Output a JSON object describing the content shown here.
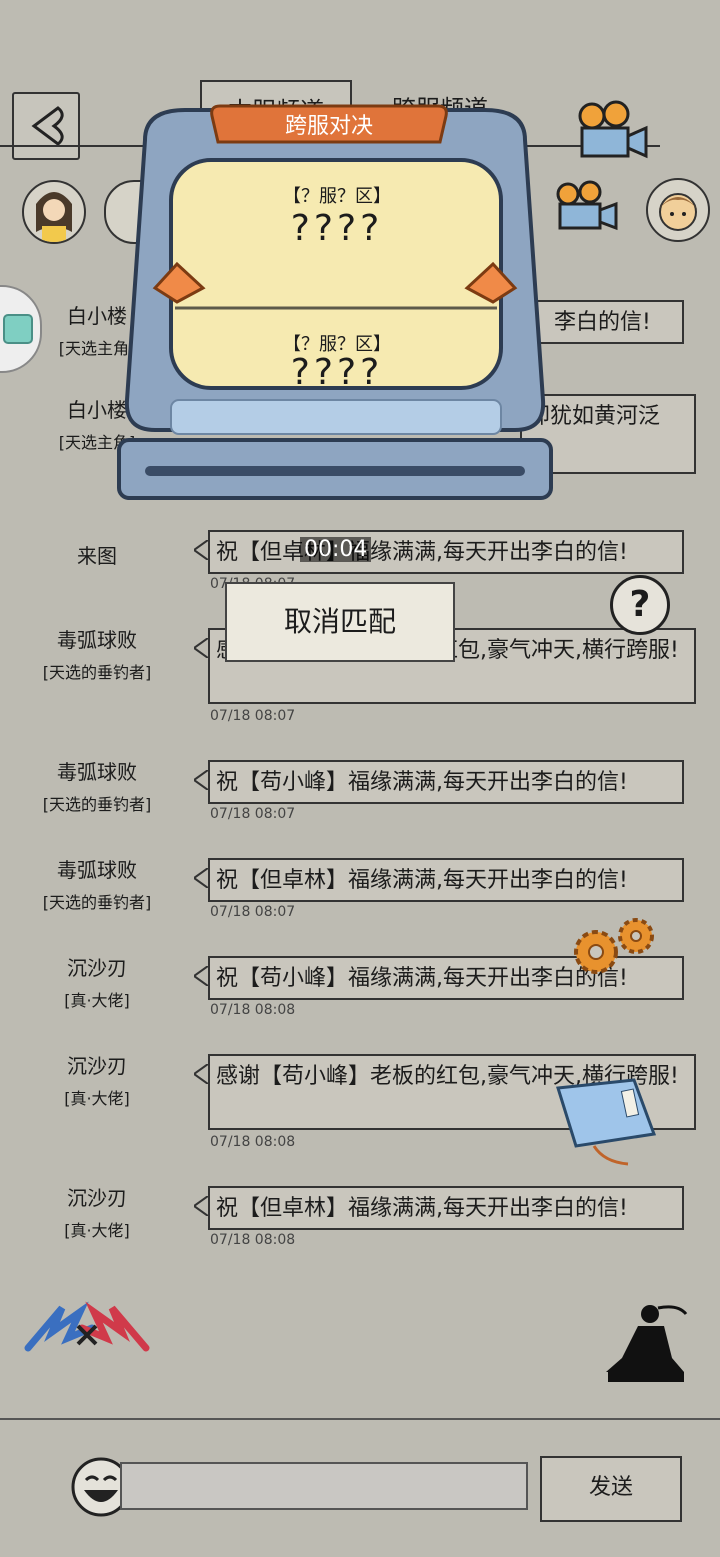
{
  "header": {
    "tabs": [
      {
        "label": "本服频道"
      },
      {
        "label": "跨服频道"
      }
    ]
  },
  "chat": {
    "rows": [
      {
        "name": "白小楼",
        "title": "[天选主角]",
        "text": "李白的信!",
        "time": ""
      },
      {
        "name": "白小楼",
        "title": "[天选主角]",
        "text": "却犹如黄河泛",
        "time": ""
      },
      {
        "name": "来图",
        "title": "",
        "text": "祝【但卓林】福缘满满,每天开出李白的信!",
        "time": "07/18 08:07"
      },
      {
        "name": "毒弧球败",
        "title": "[天选的垂钓者]",
        "text": "感谢【苟小峰】老板的红包,豪气冲天,横行跨服!",
        "time": "07/18 08:07"
      },
      {
        "name": "毒弧球败",
        "title": "[天选的垂钓者]",
        "text": "祝【苟小峰】福缘满满,每天开出李白的信!",
        "time": "07/18 08:07"
      },
      {
        "name": "毒弧球败",
        "title": "[天选的垂钓者]",
        "text": "祝【但卓林】福缘满满,每天开出李白的信!",
        "time": "07/18 08:07"
      },
      {
        "name": "沉沙刃",
        "title": "[真·大佬]",
        "text": "祝【苟小峰】福缘满满,每天开出李白的信!",
        "time": "07/18 08:08"
      },
      {
        "name": "沉沙刃",
        "title": "[真·大佬]",
        "text": "感谢【苟小峰】老板的红包,豪气冲天,横行跨服!",
        "time": "07/18 08:08"
      },
      {
        "name": "沉沙刃",
        "title": "[真·大佬]",
        "text": "祝【但卓林】福缘满满,每天开出李白的信!",
        "time": "07/18 08:08"
      }
    ]
  },
  "match_popup": {
    "title": "跨服对决",
    "top_server": "【？服？区】",
    "top_name": "????",
    "bottom_server": "【？服？区】",
    "bottom_name": "????",
    "timer": "00:04",
    "cancel_label": "取消匹配"
  },
  "composer": {
    "placeholder": "",
    "send_label": "发送"
  },
  "colors": {
    "background": "#bdbbb2",
    "bubble": "#c9c6bd",
    "popup_frame": "#8fa3bd",
    "screen": "#f6eab1",
    "title_plate": "#e0743a"
  }
}
